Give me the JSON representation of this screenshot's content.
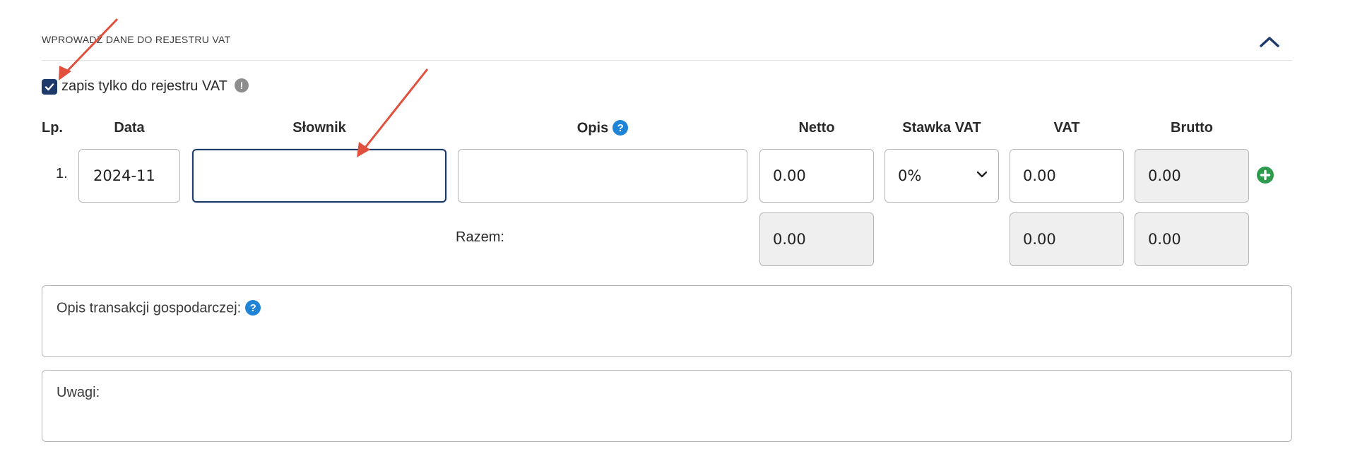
{
  "section": {
    "title": "WPROWADŹ DANE DO REJESTRU VAT"
  },
  "vat_only": {
    "label": "zapis tylko do rejestru VAT",
    "checked": true,
    "info_icon": "info-icon"
  },
  "columns": {
    "lp": "Lp.",
    "data": "Data",
    "slownik": "Słownik",
    "opis": "Opis",
    "netto": "Netto",
    "stawka": "Stawka VAT",
    "vat": "VAT",
    "brutto": "Brutto"
  },
  "row": {
    "lp": "1.",
    "data": "2024-11",
    "slownik": "",
    "opis": "",
    "netto": "0.00",
    "stawka": "0%",
    "vat": "0.00",
    "brutto": "0.00"
  },
  "totals": {
    "label": "Razem:",
    "netto": "0.00",
    "vat": "0.00",
    "brutto": "0.00"
  },
  "transaction_desc": {
    "label": "Opis transakcji gospodarczej:"
  },
  "notes": {
    "label": "Uwagi:"
  },
  "colors": {
    "accent": "#1e3a6a",
    "help": "#1f84d6",
    "add": "#2e9b4c",
    "annotation_arrow": "#e0503c"
  }
}
